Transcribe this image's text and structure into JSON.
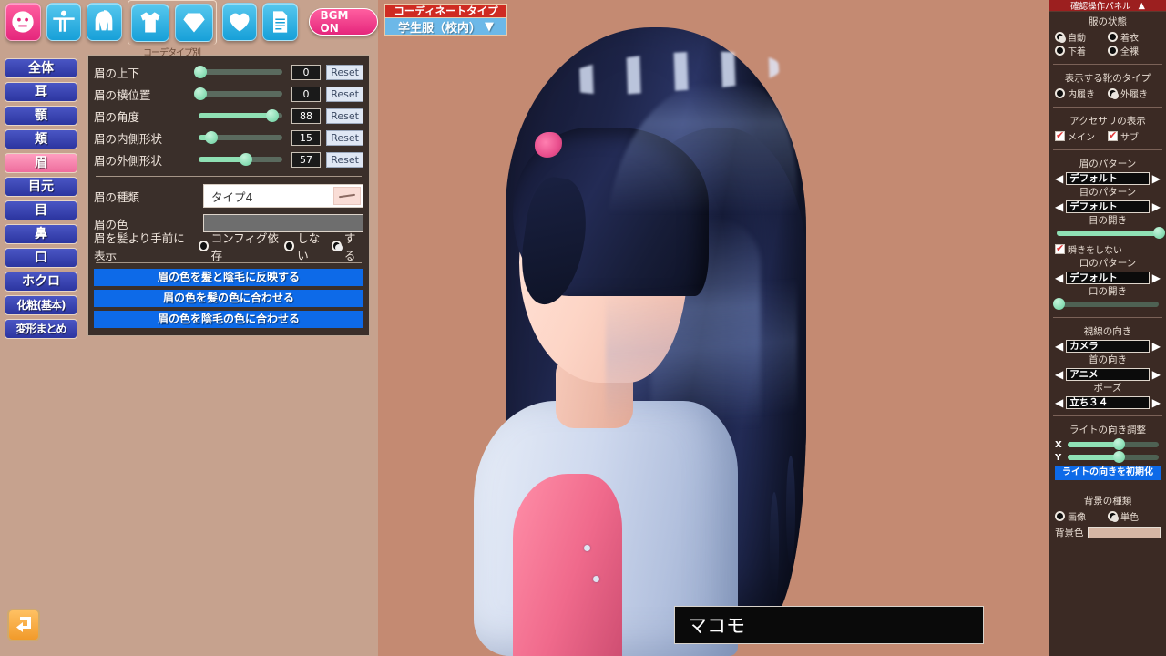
{
  "toolbar": {
    "buttons": [
      {
        "name": "face-icon",
        "glyph": "face",
        "style": "pink"
      },
      {
        "name": "body-icon",
        "glyph": "body",
        "style": "blue"
      },
      {
        "name": "hair-icon",
        "glyph": "hair",
        "style": "blue"
      },
      {
        "name": "clothes-icon",
        "glyph": "shirt",
        "style": "blue"
      },
      {
        "name": "accessory-icon",
        "glyph": "gem",
        "style": "blue"
      },
      {
        "name": "favorite-icon",
        "glyph": "heart",
        "style": "blue"
      },
      {
        "name": "profile-icon",
        "glyph": "doc",
        "style": "blue"
      }
    ],
    "group_label": "コーデタイプ別",
    "bgm_label": "BGM ON"
  },
  "categories": [
    {
      "label": "全体",
      "active": false
    },
    {
      "label": "耳",
      "active": false
    },
    {
      "label": "顎",
      "active": false
    },
    {
      "label": "頬",
      "active": false
    },
    {
      "label": "眉",
      "active": true
    },
    {
      "label": "目元",
      "active": false
    },
    {
      "label": "目",
      "active": false
    },
    {
      "label": "鼻",
      "active": false
    },
    {
      "label": "口",
      "active": false
    },
    {
      "label": "ホクロ",
      "active": false
    },
    {
      "label": "化粧(基本)",
      "active": false
    },
    {
      "label": "変形まとめ",
      "active": false
    }
  ],
  "settings": {
    "sliders": [
      {
        "label": "眉の上下",
        "value": "0",
        "percent": 2,
        "reset": "Reset"
      },
      {
        "label": "眉の横位置",
        "value": "0",
        "percent": 2,
        "reset": "Reset"
      },
      {
        "label": "眉の角度",
        "value": "88",
        "percent": 88,
        "reset": "Reset"
      },
      {
        "label": "眉の内側形状",
        "value": "15",
        "percent": 15,
        "reset": "Reset"
      },
      {
        "label": "眉の外側形状",
        "value": "57",
        "percent": 57,
        "reset": "Reset"
      }
    ],
    "type_label": "眉の種類",
    "type_value": "タイプ4",
    "color_label": "眉の色",
    "color_value": "#6e6e6e",
    "front_label": "眉を髪より手前に表示",
    "front_options": [
      {
        "label": "コンフィグ依存",
        "selected": false
      },
      {
        "label": "しない",
        "selected": false
      },
      {
        "label": "する",
        "selected": true
      }
    ],
    "actions": [
      "眉の色を髪と陰毛に反映する",
      "眉の色を髪の色に合わせる",
      "眉の色を陰毛の色に合わせる"
    ]
  },
  "back_button": "back-arrow-icon",
  "coordinate": {
    "title": "コーディネートタイプ",
    "value": "学生服（校内）",
    "caret": "▼"
  },
  "right_panel": {
    "header": "確認操作パネル",
    "header_caret": "▲",
    "clothes_state": {
      "title": "服の状態",
      "options": [
        {
          "label": "自動",
          "selected": true
        },
        {
          "label": "着衣",
          "selected": false
        },
        {
          "label": "下着",
          "selected": false
        },
        {
          "label": "全裸",
          "selected": false
        }
      ]
    },
    "shoes": {
      "title": "表示する靴のタイプ",
      "options": [
        {
          "label": "内履き",
          "selected": false
        },
        {
          "label": "外履き",
          "selected": true
        }
      ]
    },
    "accessories": {
      "title": "アクセサリの表示",
      "options": [
        {
          "label": "メイン",
          "checked": true
        },
        {
          "label": "サブ",
          "checked": true
        }
      ]
    },
    "brow_pattern": {
      "title": "眉のパターン",
      "value": "デフォルト"
    },
    "eye_pattern": {
      "title": "目のパターン",
      "value": "デフォルト"
    },
    "eye_open": {
      "title": "目の開き",
      "percent": 100
    },
    "no_blink": {
      "label": "瞬きをしない",
      "checked": true
    },
    "mouth_pattern": {
      "title": "口のパターン",
      "value": "デフォルト"
    },
    "mouth_open": {
      "title": "口の開き",
      "percent": 2
    },
    "gaze": {
      "title": "視線の向き",
      "value": "カメラ"
    },
    "neck": {
      "title": "首の向き",
      "value": "アニメ"
    },
    "pose": {
      "title": "ポーズ",
      "value": "立ち３４"
    },
    "light": {
      "title": "ライトの向き調整",
      "x_label": "X",
      "x_percent": 56,
      "y_label": "Y",
      "y_percent": 56,
      "reset_label": "ライトの向きを初期化"
    },
    "background": {
      "title": "背景の種類",
      "options": [
        {
          "label": "画像",
          "selected": false
        },
        {
          "label": "単色",
          "selected": true
        }
      ],
      "color_label": "背景色",
      "color_value": "#d6b6a4"
    }
  },
  "character": {
    "name": "マコモ"
  }
}
